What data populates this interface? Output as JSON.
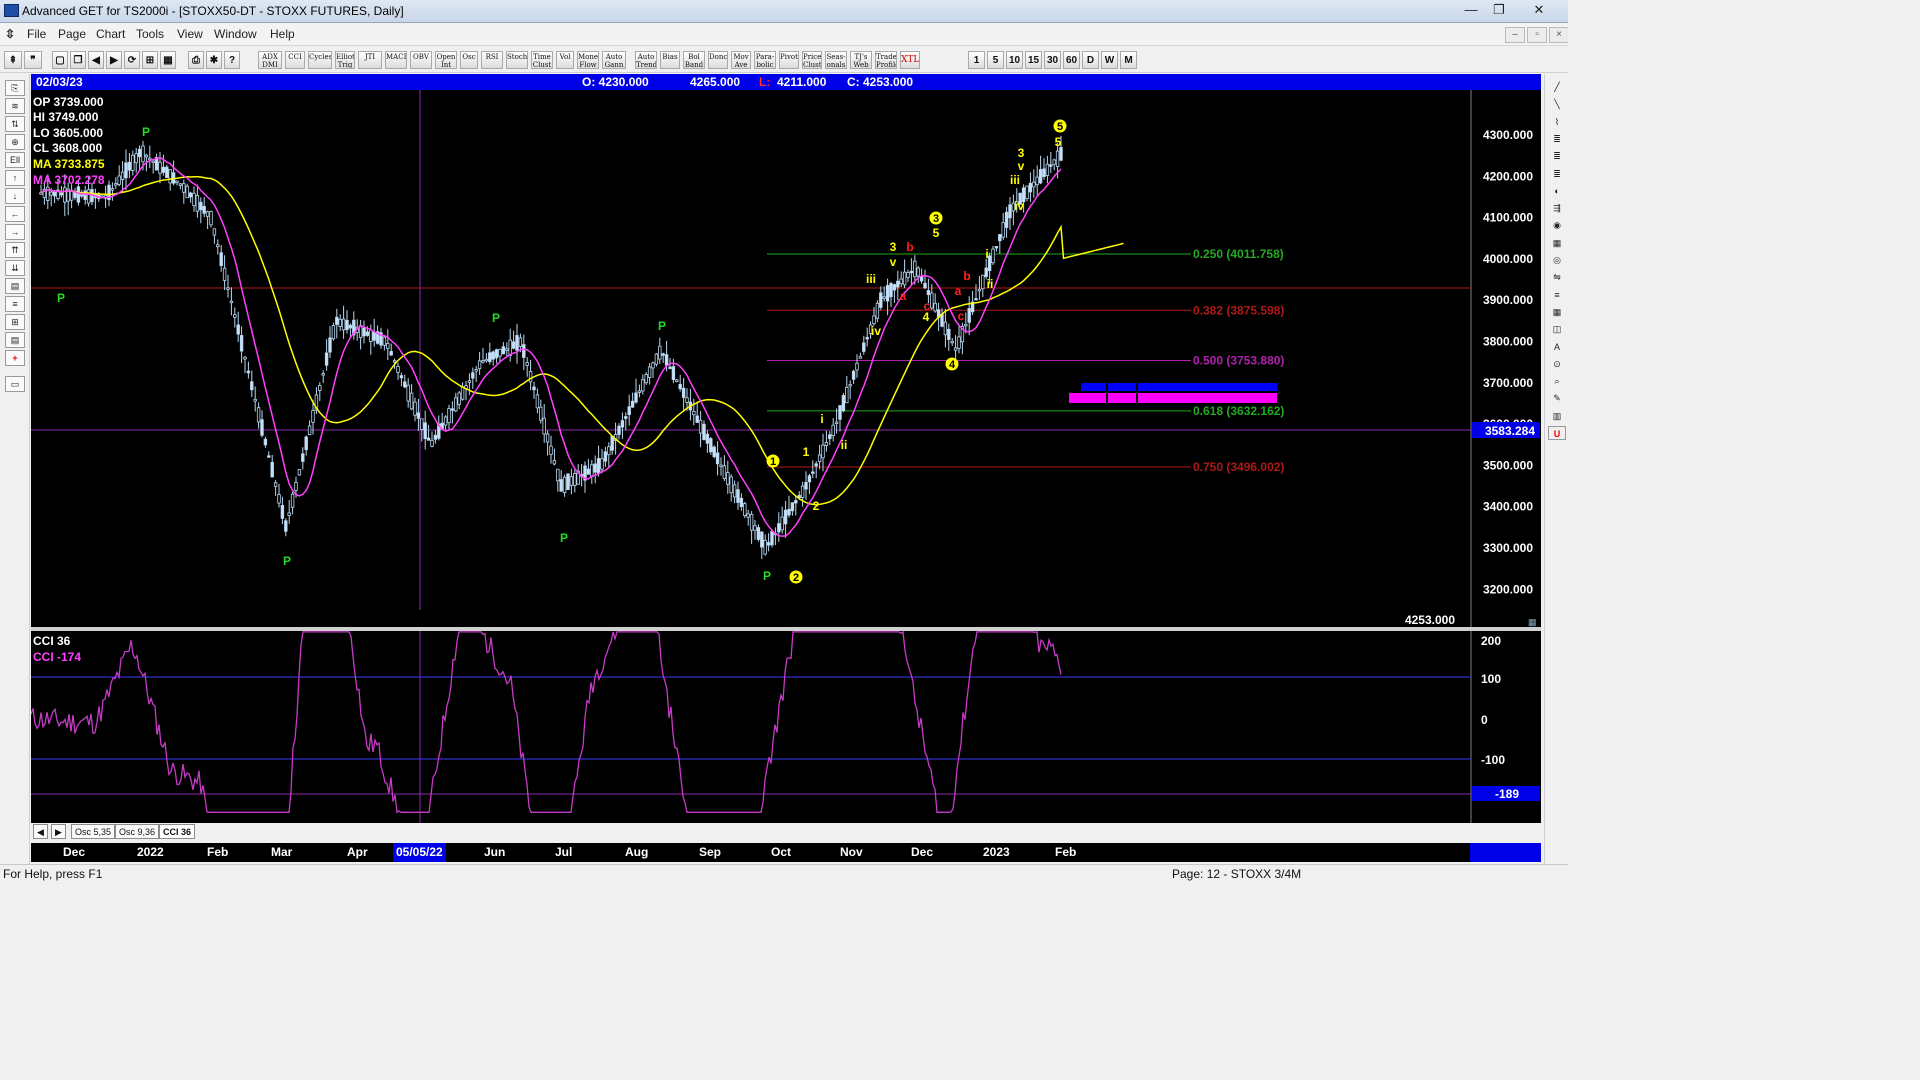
{
  "window": {
    "title": "Advanced GET for TS2000i - [STOXX50-DT - STOXX FUTURES, Daily]",
    "controls": [
      "—",
      "❐",
      "✕"
    ]
  },
  "menu": [
    "File",
    "Page",
    "Chart",
    "Tools",
    "View",
    "Window",
    "Help"
  ],
  "toolbar": {
    "studies": [
      "ADX DMI",
      "CCI",
      "Cycles",
      "Elliott Trig",
      "JTI",
      "MACD",
      "OBV",
      "Open Int",
      "Osc",
      "RSI",
      "Stoch",
      "Time Clust",
      "Vol",
      "Money Flow",
      "Auto Gann",
      "Auto Trend",
      "Bias",
      "Bol Band",
      "Donch",
      "Mov Ave",
      "Para-bolic",
      "Pivot",
      "Price Clust",
      "Seas-onals",
      "TJ's Web",
      "Trade Profile",
      "XTL"
    ],
    "intervals": [
      "1",
      "5",
      "10",
      "15",
      "30",
      "60",
      "D",
      "W",
      "M"
    ]
  },
  "infobar": {
    "date": "02/03/23",
    "open": "O: 4230.000",
    "high": "4265.000",
    "low_label": "L:",
    "low_value": "4211.000",
    "close": "C: 4253.000"
  },
  "readout": {
    "op": "OP  3739.000",
    "hi": "HI    3749.000",
    "lo": "LO   3605.000",
    "cl": "CL   3608.000",
    "ma1": "MA  3733.875",
    "ma2": "MA  3702.278"
  },
  "price_axis": {
    "ticks": [
      "4300.000",
      "4200.000",
      "4100.000",
      "4000.000",
      "3900.000",
      "3800.000",
      "3700.000",
      "3600.000",
      "3500.000",
      "3400.000",
      "3300.000",
      "3200.000"
    ],
    "cursor_value": "3583.284",
    "last_close": "4253.000"
  },
  "fib_levels": [
    {
      "label": "0.250 (4011.758)",
      "price": 4011.758,
      "color": "#22aa22"
    },
    {
      "label": "0.382 (3875.598)",
      "price": 3875.598,
      "color": "#b01818"
    },
    {
      "label": "0.500 (3753.880)",
      "price": 3753.88,
      "color": "#b020b0"
    },
    {
      "label": "0.618 (3632.162)",
      "price": 3632.162,
      "color": "#22aa22"
    },
    {
      "label": "0.750 (3496.002)",
      "price": 3496.002,
      "color": "#b01818"
    }
  ],
  "wave_labels": {
    "pivots": [
      "P",
      "P",
      "P",
      "P",
      "P",
      "P",
      "P"
    ],
    "circled": [
      "1",
      "2",
      "3",
      "4",
      "5"
    ],
    "minor": [
      "1",
      "2",
      "3",
      "4",
      "5",
      "3",
      "5",
      "i",
      "ii",
      "iii",
      "iv",
      "v",
      "iii",
      "iv",
      "v",
      "a",
      "b",
      "c",
      "a",
      "b",
      "c",
      "i",
      "ii"
    ]
  },
  "oscillator": {
    "name": "CCI 36",
    "value_text": "CCI  -174",
    "ticks": [
      "200",
      "100",
      "0",
      "-100"
    ],
    "cursor_value": "-189"
  },
  "osc_tabs": [
    "Osc 5,35",
    "Osc 9,36",
    "CCI 36"
  ],
  "time_axis": [
    "Dec",
    "2022",
    "Feb",
    "Mar",
    "Apr",
    "05/05/22",
    "Jun",
    "Jul",
    "Aug",
    "Sep",
    "Oct",
    "Nov",
    "Dec",
    "2023",
    "Feb"
  ],
  "status": {
    "help": "For Help, press F1",
    "page": "Page: 12 - STOXX 3/4M"
  },
  "chart_data": {
    "type": "candlestick",
    "interval": "Daily",
    "date_range": [
      "2021-11",
      "2023-02-03"
    ],
    "ylim": [
      3150,
      4380
    ],
    "close_path": [
      [
        "2021-11",
        4160
      ],
      [
        "2021-12",
        4150
      ],
      [
        "2022-01",
        4260
      ],
      [
        "2022-01",
        4180
      ],
      [
        "2022-02",
        4100
      ],
      [
        "2022-03",
        3350
      ],
      [
        "2022-03",
        3850
      ],
      [
        "2022-04",
        3800
      ],
      [
        "2022-05",
        3550
      ],
      [
        "2022-05",
        3750
      ],
      [
        "2022-06",
        3800
      ],
      [
        "2022-06",
        3450
      ],
      [
        "2022-07",
        3500
      ],
      [
        "2022-08",
        3780
      ],
      [
        "2022-09",
        3500
      ],
      [
        "2022-09",
        3300
      ],
      [
        "2022-10",
        3450
      ],
      [
        "2022-10",
        3600
      ],
      [
        "2022-11",
        3900
      ],
      [
        "2022-12",
        3980
      ],
      [
        "2022-12",
        3780
      ],
      [
        "2023-01",
        4120
      ],
      [
        "2023-02",
        4253
      ]
    ],
    "moving_averages": [
      "MA 3733.875",
      "MA 3702.278"
    ],
    "grid": false
  }
}
